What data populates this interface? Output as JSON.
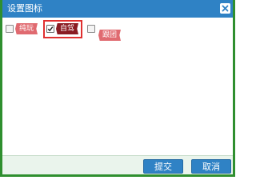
{
  "dialog": {
    "title": "设置图标"
  },
  "icons": [
    {
      "label": "纯玩",
      "checked": false
    },
    {
      "label": "自驾",
      "checked": true
    },
    {
      "label": "跟团",
      "checked": false
    }
  ],
  "footer": {
    "submit_label": "提交",
    "cancel_label": "取消"
  },
  "colors": {
    "accent": "#2f82c5",
    "tag": "#d1333a",
    "selection": "#e03030",
    "frame": "#2f8f2f"
  }
}
